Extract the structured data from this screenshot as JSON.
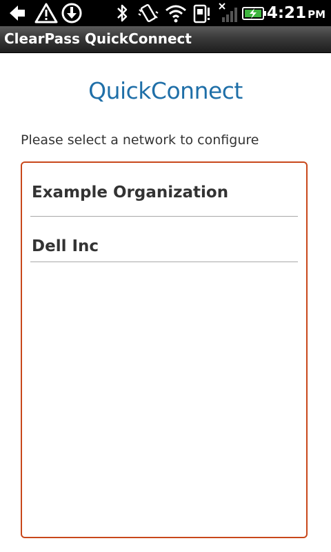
{
  "status_bar": {
    "icons": [
      "back-arrow-icon",
      "warning-icon",
      "download-icon",
      "bluetooth-icon",
      "vibrate-icon",
      "wifi-icon",
      "sd-card-icon",
      "no-signal-icon",
      "battery-charging-icon"
    ],
    "time": "4:21",
    "ampm": "PM"
  },
  "title_bar": {
    "title": "ClearPass QuickConnect"
  },
  "logo": {
    "text": "QuickConnect",
    "color": "#1f6fa8"
  },
  "prompt": "Please select a network to configure",
  "networks": [
    {
      "label": "Example Organization"
    },
    {
      "label": "Dell Inc"
    }
  ],
  "colors": {
    "list_border": "#c8471a",
    "divider": "#a8a8a8"
  }
}
